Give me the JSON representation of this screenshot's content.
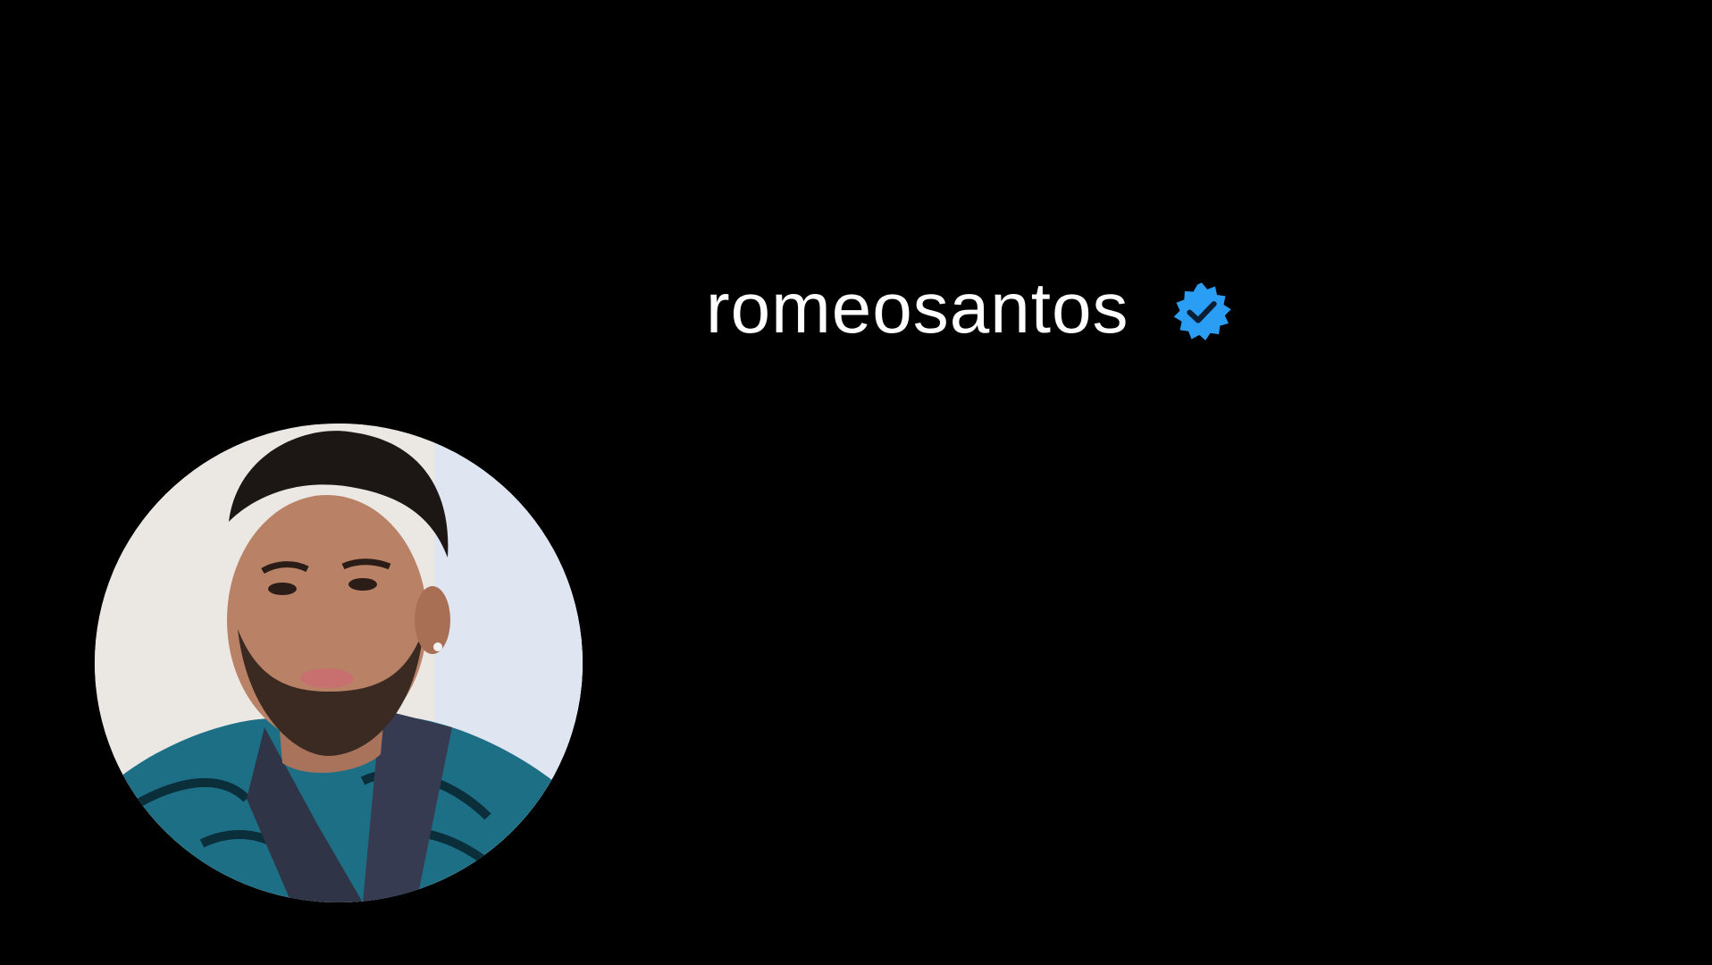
{
  "profile": {
    "username": "romeosantos",
    "verified": true,
    "verified_icon": "verified-badge-icon",
    "avatar_icon": "profile-photo"
  },
  "colors": {
    "background": "#000000",
    "username_text": "#ffffff",
    "verified_badge": "#2a9df4"
  }
}
